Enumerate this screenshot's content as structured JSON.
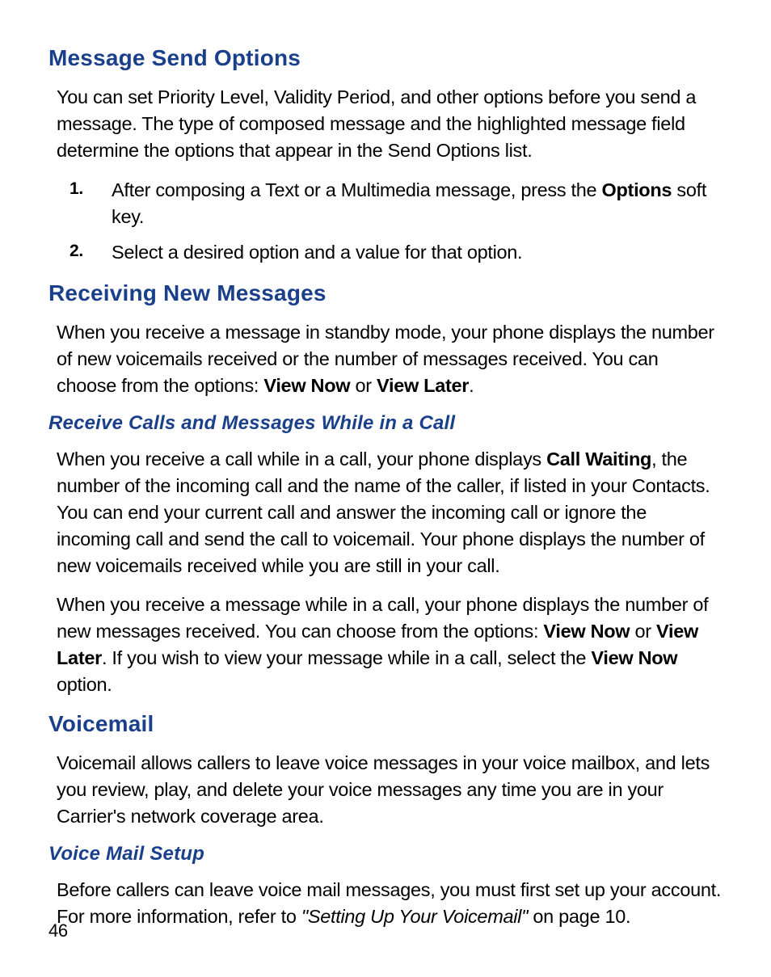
{
  "section1": {
    "title": "Message Send Options",
    "para1": "You can set Priority Level, Validity Period, and other options before you send a message. The type of composed message and the highlighted message field determine the options that appear in the Send Options list.",
    "step1_pre": "After composing a Text or a Multimedia message, press the ",
    "step1_bold": "Options",
    "step1_post": " soft key.",
    "step2": "Select a desired option and a value for that option."
  },
  "section2": {
    "title": "Receiving New Messages",
    "para1_pre": "When you receive a message in standby mode, your phone displays the number of new voicemails received or the number of messages received. You can choose from the options: ",
    "para1_b1": "View Now",
    "para1_mid": " or ",
    "para1_b2": "View Later",
    "para1_post": ".",
    "sub_title": "Receive Calls and Messages While in a Call",
    "para2_pre": "When you receive a call while in a call, your phone displays ",
    "para2_b1": "Call Waiting",
    "para2_post": ", the number of the incoming call and the name of the caller, if listed in your Contacts. You can end your current call and answer the incoming call or ignore the incoming call and send the call to voicemail. Your phone displays the number of new voicemails received while you are still in your call.",
    "para3_pre": "When you receive a message while in a call, your phone displays the number of new messages received. You can choose from the options: ",
    "para3_b1": "View Now",
    "para3_mid1": " or ",
    "para3_b2": "View Later",
    "para3_mid2": ". If you wish to view your message while in a call, select the ",
    "para3_b3": "View Now",
    "para3_post": " option."
  },
  "section3": {
    "title": "Voicemail",
    "para1": "Voicemail allows callers to leave voice messages in your voice mailbox, and lets you review, play, and delete your voice messages any time you are in your Carrier's network coverage area.",
    "sub_title": "Voice Mail Setup",
    "para2_pre": "Before callers can leave voice mail messages, you must first set up your account. For more information, refer to ",
    "para2_quote": "\"Setting Up Your Voicemail\"",
    "para2_post": " on page 10."
  },
  "numbers": {
    "one": "1.",
    "two": "2."
  },
  "page_number": "46"
}
